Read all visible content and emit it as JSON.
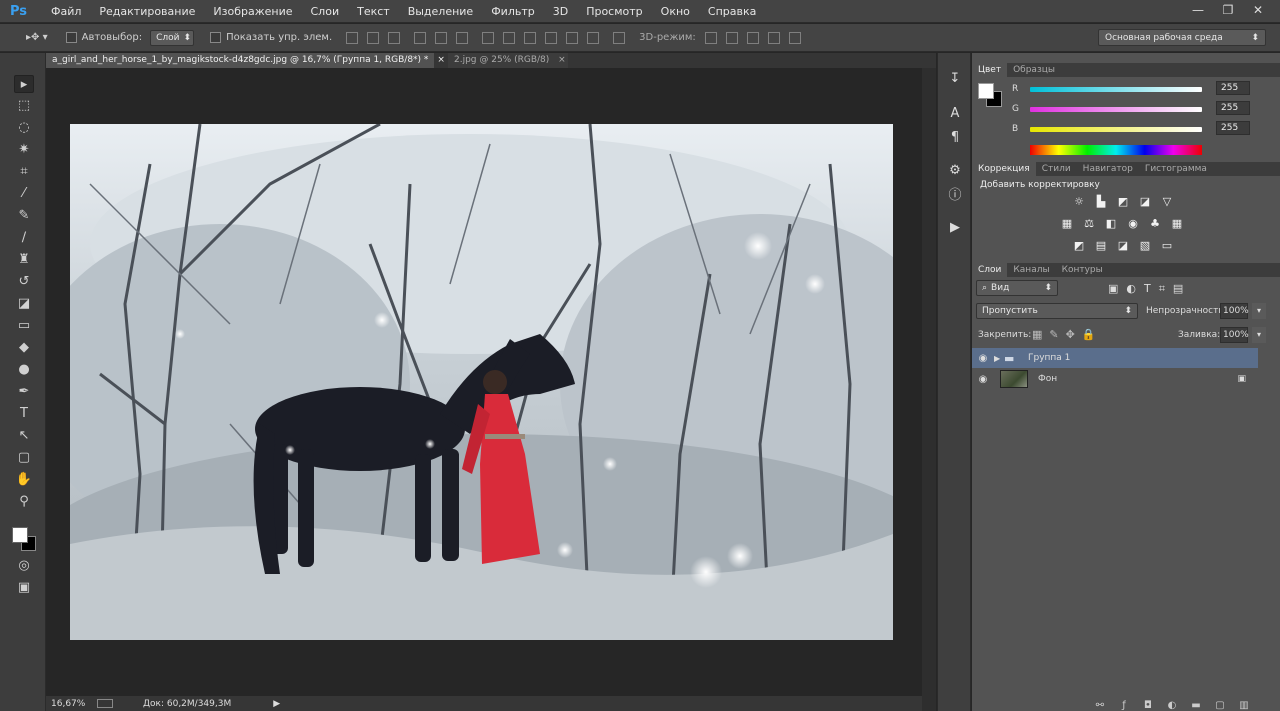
{
  "app": {
    "logo": "Ps"
  },
  "menu": [
    "Файл",
    "Редактирование",
    "Изображение",
    "Слои",
    "Текст",
    "Выделение",
    "Фильтр",
    "3D",
    "Просмотр",
    "Окно",
    "Справка"
  ],
  "window_controls": {
    "minimize": "—",
    "restore": "❐",
    "close": "✕"
  },
  "options": {
    "autoselect_label": "Автовыбор:",
    "autoselect_value": "Слой",
    "show_controls_label": "Показать упр. элем.",
    "mode_3d_label": "3D-режим:",
    "workspace": "Основная рабочая среда"
  },
  "tabs": [
    {
      "label": "a_girl_and_her_horse_1_by_magikstock-d4z8gdc.jpg @ 16,7% (Группа 1, RGB/8*) *",
      "close": "×"
    },
    {
      "label": "2.jpg @ 25% (RGB/8)",
      "close": "×"
    }
  ],
  "status": {
    "zoom": "16,67%",
    "doc": "Док: 60,2M/349,3M"
  },
  "color_panel": {
    "tabs": [
      "Цвет",
      "Образцы"
    ],
    "channels": [
      {
        "label": "R",
        "value": "255",
        "gradient": [
          "#00c0d8",
          "#ffffff"
        ]
      },
      {
        "label": "G",
        "value": "255",
        "gradient": [
          "#e030e0",
          "#ffffff"
        ]
      },
      {
        "label": "B",
        "value": "255",
        "gradient": [
          "#e6e600",
          "#ffffff"
        ]
      }
    ]
  },
  "adjust_panel": {
    "tabs": [
      "Коррекция",
      "Стили",
      "Навигатор",
      "Гистограмма"
    ],
    "title": "Добавить корректировку"
  },
  "layers_panel": {
    "tabs": [
      "Слои",
      "Каналы",
      "Контуры"
    ],
    "filter": "Вид",
    "blend": "Пропустить",
    "opacity_label": "Непрозрачность:",
    "opacity": "100%",
    "lock_label": "Закрепить:",
    "fill_label": "Заливка:",
    "fill": "100%",
    "layers": [
      {
        "name": "Группа 1",
        "type": "group",
        "selected": true
      },
      {
        "name": "Фон",
        "type": "image",
        "selected": false,
        "locked": true
      }
    ]
  },
  "colors": {
    "accent": "#3aa0f0",
    "selected_layer": "#5a6e8c"
  }
}
